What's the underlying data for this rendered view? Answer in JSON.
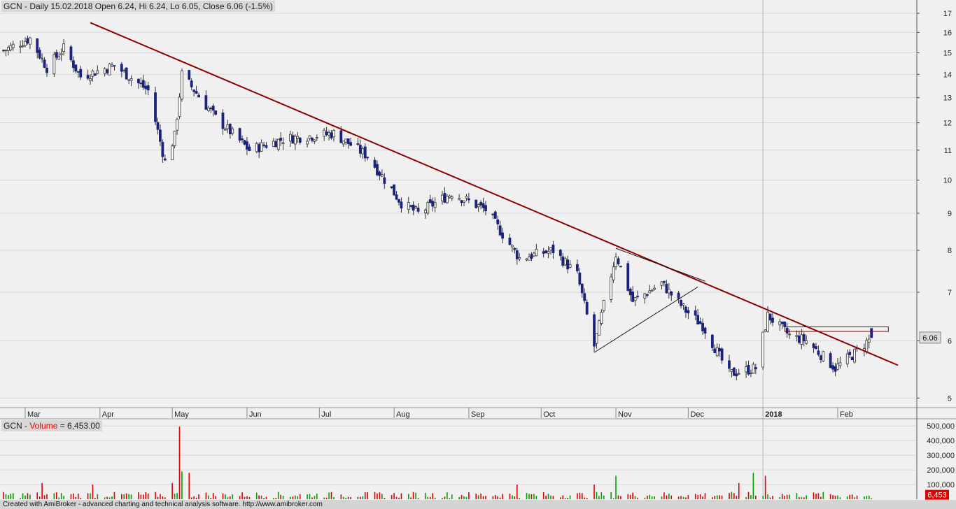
{
  "price_header": {
    "text": "GCN - Daily 15.02.2018 Open 6.24, Hi 6.24, Lo 6.05, Close 6.06 (-1.5%)"
  },
  "volume_header": {
    "prefix": "GCN - ",
    "label": "Volume",
    "value_text": " = 6,453.00"
  },
  "footer": {
    "text": "Created with AmiBroker - advanced charting and technical analysis software. http://www.amibroker.com"
  },
  "colors": {
    "background": "#f0f0f0",
    "down_candle": "#1a237e",
    "up_candle": "#ffffff",
    "trendline": "#8b0000",
    "volume_up": "#00a000",
    "volume_down": "#e00000",
    "grid": "#d8d8d8"
  },
  "chart_data": [
    {
      "type": "candlestick",
      "symbol": "GCN",
      "scale": "log",
      "ylim": [
        4.85,
        17.5
      ],
      "y_ticks": [
        5,
        6,
        7,
        8,
        9,
        10,
        11,
        12,
        13,
        14,
        15,
        16,
        17
      ],
      "months": [
        "Mar",
        "Apr",
        "May",
        "Jun",
        "Jul",
        "Aug",
        "Sep",
        "Oct",
        "Nov",
        "Dec",
        "2018",
        "Feb"
      ],
      "last_close_label": "6.06",
      "ohlc_waypoints": [
        {
          "date": "2017-02-20",
          "close": 15.1
        },
        {
          "date": "2017-03-03",
          "close": 15.7
        },
        {
          "date": "2017-03-10",
          "close": 14.3
        },
        {
          "date": "2017-03-17",
          "close": 15.2
        },
        {
          "date": "2017-03-24",
          "close": 13.9
        },
        {
          "date": "2017-04-07",
          "close": 14.4
        },
        {
          "date": "2017-04-21",
          "close": 13.3
        },
        {
          "date": "2017-04-28",
          "close": 10.6
        },
        {
          "date": "2017-05-02",
          "close": 11.5
        },
        {
          "date": "2017-05-05",
          "close": 14.0
        },
        {
          "date": "2017-05-19",
          "close": 12.2
        },
        {
          "date": "2017-06-02",
          "close": 11.0
        },
        {
          "date": "2017-06-16",
          "close": 11.4
        },
        {
          "date": "2017-07-07",
          "close": 11.6
        },
        {
          "date": "2017-07-21",
          "close": 10.8
        },
        {
          "date": "2017-08-04",
          "close": 9.3
        },
        {
          "date": "2017-08-11",
          "close": 9.0
        },
        {
          "date": "2017-08-25",
          "close": 9.6
        },
        {
          "date": "2017-09-08",
          "close": 9.1
        },
        {
          "date": "2017-09-22",
          "close": 7.8
        },
        {
          "date": "2017-10-06",
          "close": 8.0
        },
        {
          "date": "2017-10-16",
          "close": 7.4
        },
        {
          "date": "2017-10-23",
          "close": 5.9
        },
        {
          "date": "2017-11-01",
          "close": 7.9
        },
        {
          "date": "2017-11-08",
          "close": 6.8
        },
        {
          "date": "2017-11-20",
          "close": 7.2
        },
        {
          "date": "2017-11-30",
          "close": 6.6
        },
        {
          "date": "2017-12-07",
          "close": 6.3
        },
        {
          "date": "2017-12-18",
          "close": 5.4
        },
        {
          "date": "2017-12-29",
          "close": 5.5
        },
        {
          "date": "2018-01-03",
          "close": 6.5
        },
        {
          "date": "2018-01-12",
          "close": 6.1
        },
        {
          "date": "2018-01-19",
          "close": 6.0
        },
        {
          "date": "2018-01-31",
          "close": 5.5
        },
        {
          "date": "2018-02-09",
          "close": 5.8
        },
        {
          "date": "2018-02-15",
          "close": 6.06
        }
      ],
      "last_bar": {
        "date": "2018-02-15",
        "open": 6.24,
        "high": 6.24,
        "low": 6.05,
        "close": 6.06
      },
      "trendlines": [
        {
          "from": {
            "date": "2017-03-28",
            "price": 16.5
          },
          "to": {
            "date": "2018-02-26",
            "price": 5.55
          }
        },
        {
          "from": {
            "date": "2017-10-23",
            "price": 5.78
          },
          "to": {
            "date": "2017-12-05",
            "price": 7.12
          }
        },
        {
          "from": {
            "date": "2017-11-01",
            "price": 8.05
          },
          "to": {
            "date": "2017-12-08",
            "price": 7.25
          }
        }
      ],
      "resistance_box": {
        "from_date": "2018-01-10",
        "to_date": "2018-02-22",
        "low": 6.18,
        "high": 6.27
      }
    },
    {
      "type": "bar",
      "name": "Volume",
      "ylim": [
        0,
        520000
      ],
      "y_ticks": [
        100000,
        200000,
        300000,
        400000,
        500000
      ],
      "y_tick_labels": [
        "100,000",
        "200,000",
        "300,000",
        "400,000",
        "500,000"
      ],
      "last_value": 6453,
      "last_value_label": "6,453",
      "spikes": [
        {
          "date": "2017-05-04",
          "value": 495000,
          "color": "red"
        },
        {
          "date": "2017-05-05",
          "value": 190000,
          "color": "green"
        },
        {
          "date": "2017-05-08",
          "value": 180000,
          "color": "red"
        },
        {
          "date": "2017-05-01",
          "value": 110000,
          "color": "red"
        },
        {
          "date": "2017-03-08",
          "value": 110000,
          "color": "red"
        },
        {
          "date": "2017-03-29",
          "value": 100000,
          "color": "red"
        },
        {
          "date": "2017-10-23",
          "value": 100000,
          "color": "red"
        },
        {
          "date": "2017-11-01",
          "value": 160000,
          "color": "green"
        },
        {
          "date": "2017-12-22",
          "value": 110000,
          "color": "red"
        },
        {
          "date": "2017-12-28",
          "value": 180000,
          "color": "green"
        },
        {
          "date": "2018-01-02",
          "value": 160000,
          "color": "red"
        },
        {
          "date": "2017-09-21",
          "value": 100000,
          "color": "red"
        }
      ]
    }
  ]
}
